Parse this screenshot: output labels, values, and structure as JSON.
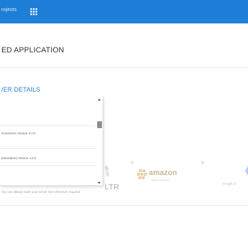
{
  "topbar": {
    "projects_label": "rojects",
    "apps_icon": "grid-apps-icon",
    "bg_color": "#1e7fd9"
  },
  "page": {
    "title": "ED APPLICATION",
    "section_title": "/ER DETAILS",
    "accent_color": "#1e7fd9"
  },
  "dropdown": {
    "options": [
      "Commerce Version 3.2.6",
      "ptimization) Version 4.9.2"
    ]
  },
  "providers": {
    "ltr_label": "LTR",
    "aws": {
      "word": "amazon",
      "sub": "web services"
    },
    "google": {
      "label": "Google Cl"
    }
  },
  "footer": {
    "note": "You can always scale your server size whenever required."
  }
}
